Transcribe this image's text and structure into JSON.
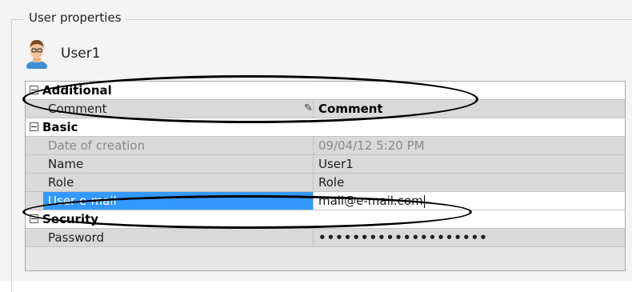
{
  "group": {
    "title": "User properties"
  },
  "user": {
    "name": "User1",
    "avatar_icon": "user-avatar-icon"
  },
  "categories": [
    {
      "label": "Additional",
      "toggle": "collapse",
      "props": [
        {
          "name": "Comment",
          "value": "Comment",
          "editable_icon": "pencil-icon"
        }
      ]
    },
    {
      "label": "Basic",
      "toggle": "collapse",
      "props": [
        {
          "name": "Date of creation",
          "value": "09/04/12 5:20 PM"
        },
        {
          "name": "Name",
          "value": "User1"
        },
        {
          "name": "Role",
          "value": "Role"
        },
        {
          "name": "User e-mail",
          "value": "mail@e-mail.com"
        }
      ]
    },
    {
      "label": "Security",
      "toggle": "collapse",
      "props": [
        {
          "name": "Password",
          "value": "••••••••••••••••••••"
        }
      ]
    }
  ],
  "colors": {
    "selection": "#3399ff",
    "grid_row": "#d9d9d9",
    "category_row": "#ffffff",
    "panel": "#f4f4f4"
  }
}
